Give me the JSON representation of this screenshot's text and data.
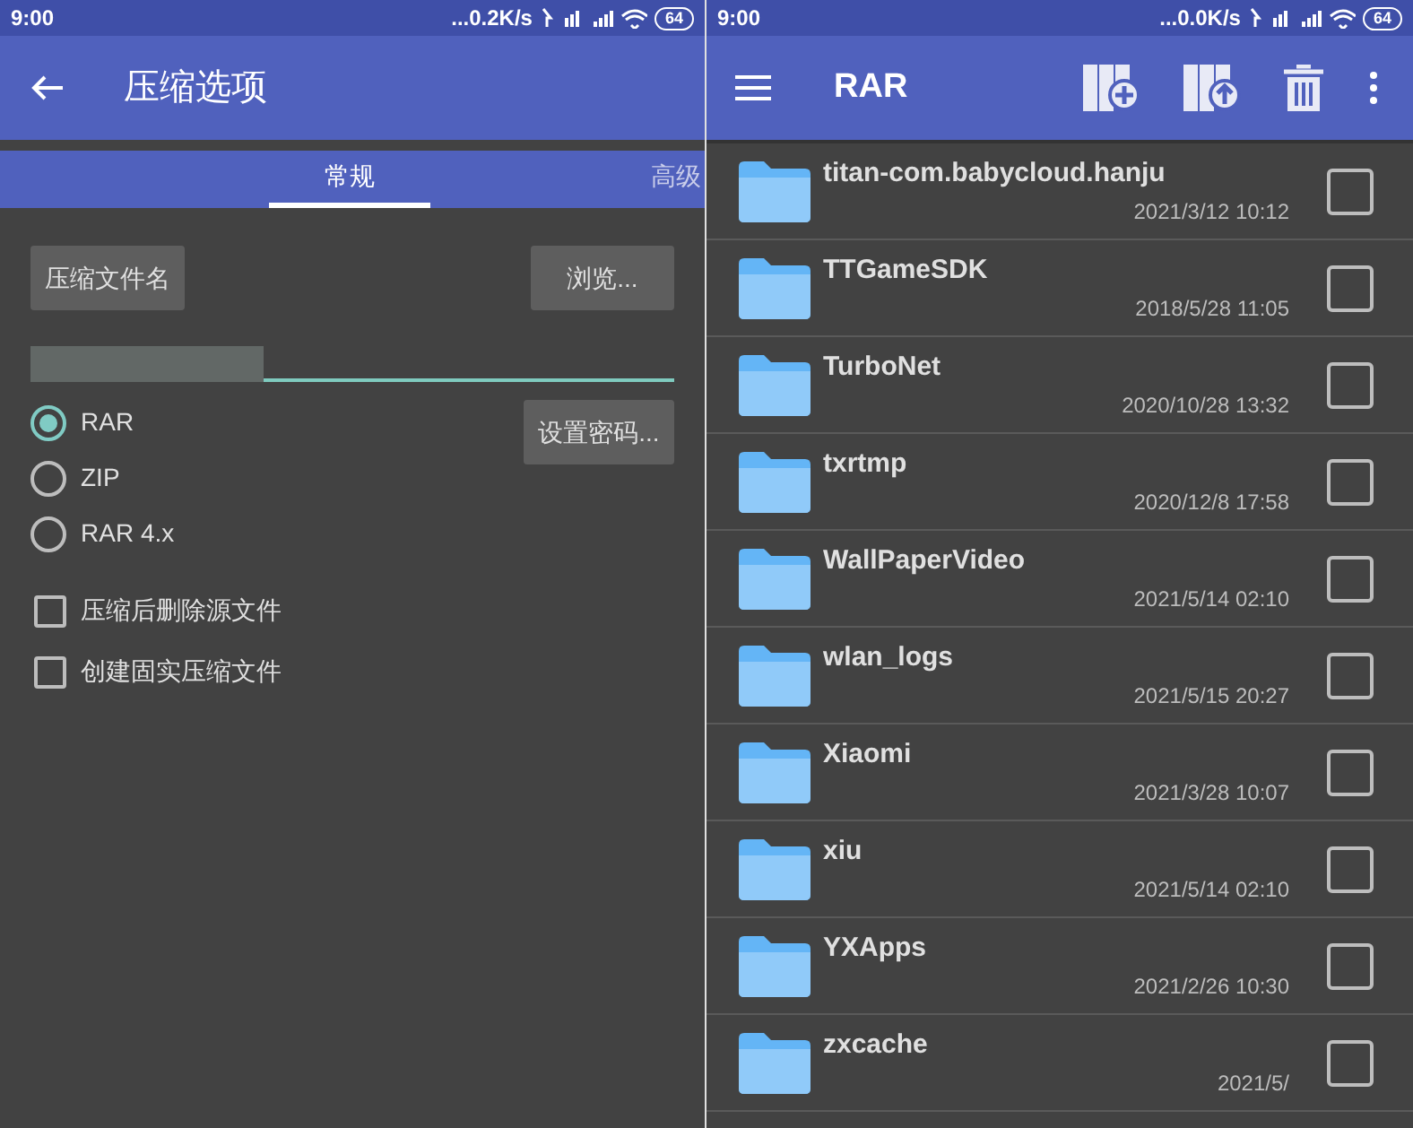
{
  "left": {
    "status_bar": {
      "time": "9:00",
      "speed": "...0.2K/s",
      "battery": "64"
    },
    "app_bar": {
      "title": "压缩选项"
    },
    "tabs": [
      {
        "label": "常规",
        "selected": true
      },
      {
        "label": "高级",
        "selected": false
      }
    ],
    "name_button": "压缩文件名",
    "browse_button": "浏览...",
    "formats": [
      {
        "label": "RAR",
        "selected": true
      },
      {
        "label": "ZIP",
        "selected": false
      },
      {
        "label": "RAR 4.x",
        "selected": false
      }
    ],
    "password_button": "设置密码...",
    "options": [
      {
        "label": "压缩后删除源文件",
        "checked": false
      },
      {
        "label": "创建固实压缩文件",
        "checked": false
      }
    ]
  },
  "right": {
    "status_bar": {
      "time": "9:00",
      "speed": "...0.0K/s",
      "battery": "64"
    },
    "app_bar": {
      "title": "RAR"
    },
    "files": [
      {
        "name": "titan-com.babycloud.hanju",
        "date": "2021/3/12 10:12",
        "checked": false
      },
      {
        "name": "TTGameSDK",
        "date": "2018/5/28 11:05",
        "checked": false
      },
      {
        "name": "TurboNet",
        "date": "2020/10/28 13:32",
        "checked": false
      },
      {
        "name": "txrtmp",
        "date": "2020/12/8 17:58",
        "checked": false
      },
      {
        "name": "WallPaperVideo",
        "date": "2021/5/14 02:10",
        "checked": false
      },
      {
        "name": "wlan_logs",
        "date": "2021/5/15 20:27",
        "checked": false
      },
      {
        "name": "Xiaomi",
        "date": "2021/3/28 10:07",
        "checked": false
      },
      {
        "name": "xiu",
        "date": "2021/5/14 02:10",
        "checked": false
      },
      {
        "name": "YXApps",
        "date": "2021/2/26 10:30",
        "checked": false
      },
      {
        "name": "zxcache",
        "date": "2021/5/",
        "checked": false
      }
    ]
  }
}
